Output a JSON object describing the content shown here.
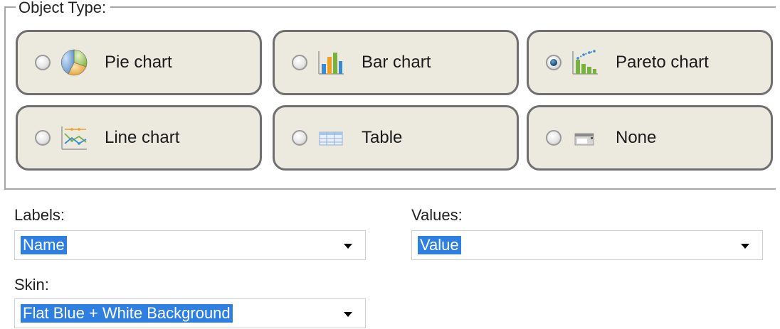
{
  "object_type": {
    "legend": "Object Type:",
    "selected": "pareto",
    "options": [
      {
        "id": "pie",
        "label": "Pie chart",
        "icon": "pie-chart-icon",
        "checked": false
      },
      {
        "id": "bar",
        "label": "Bar chart",
        "icon": "bar-chart-icon",
        "checked": false
      },
      {
        "id": "pareto",
        "label": "Pareto chart",
        "icon": "pareto-chart-icon",
        "checked": true
      },
      {
        "id": "line",
        "label": "Line chart",
        "icon": "line-chart-icon",
        "checked": false
      },
      {
        "id": "table",
        "label": "Table",
        "icon": "table-icon",
        "checked": false
      },
      {
        "id": "none",
        "label": "None",
        "icon": "none-icon",
        "checked": false
      }
    ]
  },
  "labels": {
    "label": "Labels:",
    "value": "Name"
  },
  "values": {
    "label": "Values:",
    "value": "Value"
  },
  "skin": {
    "label": "Skin:",
    "value": "Flat Blue + White Background"
  },
  "colors": {
    "tile_background": "#ece9df",
    "tile_border": "#6f6f6f",
    "selection_highlight": "#2f7fe0"
  }
}
